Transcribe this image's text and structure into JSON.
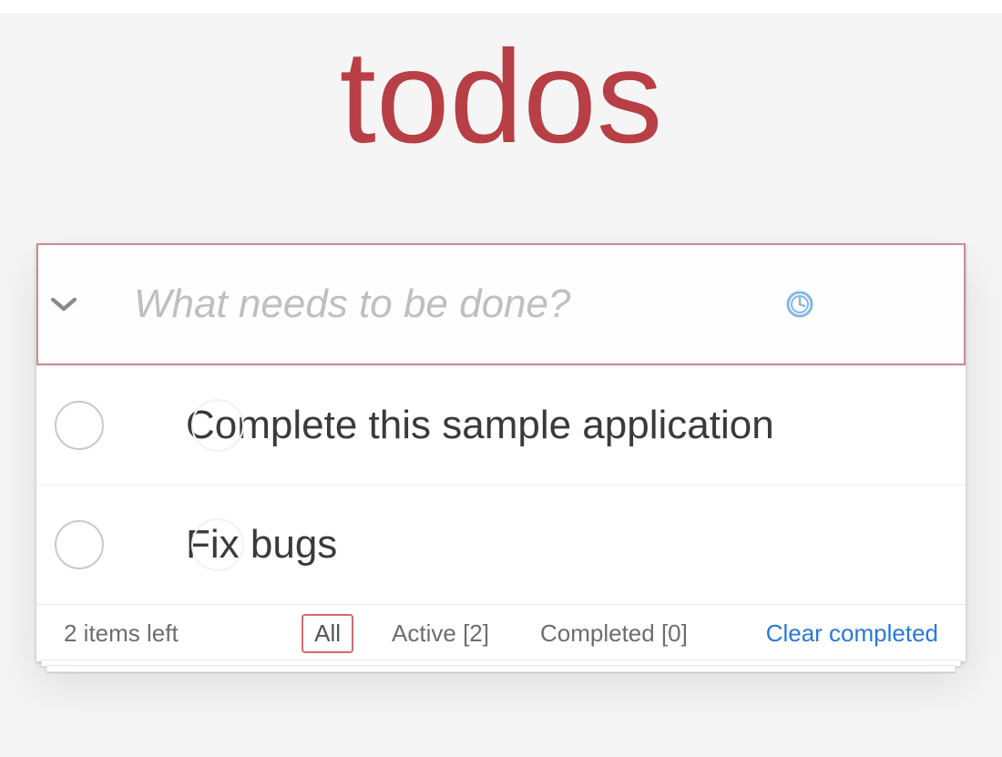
{
  "header": {
    "title": "todos"
  },
  "input": {
    "placeholder": "What needs to be done?",
    "value": ""
  },
  "todos": [
    {
      "text": "Complete this sample application",
      "completed": false
    },
    {
      "text": "Fix bugs",
      "completed": false
    }
  ],
  "footer": {
    "count_text": "2 items left",
    "filters": {
      "all": "All",
      "active": "Active [2]",
      "completed": "Completed [0]",
      "selected": "all"
    },
    "clear_label": "Clear completed"
  },
  "icons": {
    "toggle_all": "chevron-down-icon",
    "clock": "clock-icon"
  },
  "colors": {
    "accent": "#b83f45",
    "link": "#2878d7",
    "border_focus": "#c88d90"
  }
}
